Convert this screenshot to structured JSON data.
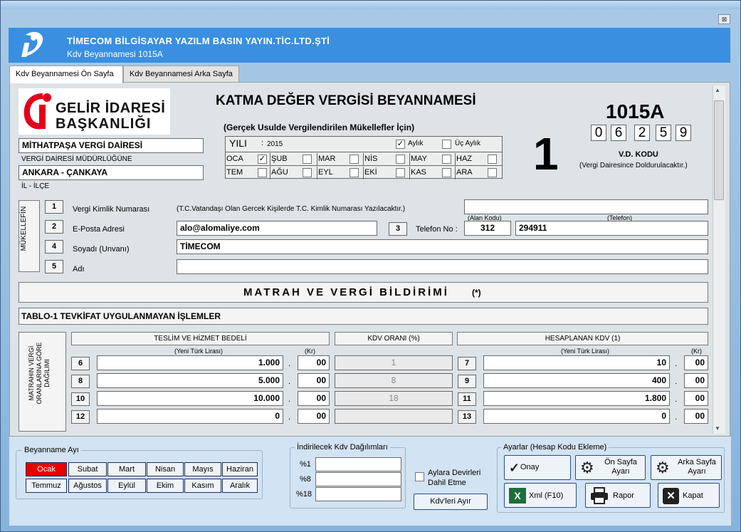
{
  "window": {
    "company": "TİMECOM BİLGİSAYAR YAZILM BASIN YAYIN.TİC.LTD.ŞTİ",
    "subtitle": "Kdv Beyannamesi 1015A",
    "close": "⊠"
  },
  "tabs": [
    "Kdv Beyannamesi Ön Sayfa",
    "Kdv Beyannamesi Arka Sayfa"
  ],
  "logo": {
    "line1": "GELİR İDARESİ",
    "line2": "BAŞKANLIĞI",
    "brand_color": "#e3001b"
  },
  "form": {
    "title": "KATMA DEĞER VERGİSİ BEYANNAMESİ",
    "subtitle": "(Gerçek Usulde Vergilendirilen Mükellefler İçin)",
    "code": "1015A",
    "vd_digits": [
      "0",
      "6",
      "2",
      "5",
      "9"
    ],
    "vd_label": "V.D. KODU",
    "vd_note": "(Vergi Dairesince Doldurulacaktır.)",
    "big_number": "1",
    "office": "MİTHATPAŞA VERGİ DAİRESİ",
    "office_label": "VERGİ DAİRESİ MÜDÜRLÜĞÜNE",
    "city": "ANKARA - ÇANKAYA",
    "city_label": "İL - İLÇE",
    "year_label": "YILI",
    "year_sep": ":",
    "year": "2015",
    "monthly": "Aylık",
    "quarterly": "Üç Aylık",
    "months": [
      "OCA",
      "ŞUB",
      "MAR",
      "NİS",
      "MAY",
      "HAZ",
      "TEM",
      "AĞU",
      "EYL",
      "EKİ",
      "KAS",
      "ARA"
    ],
    "taxpayer_vertical": "MÜKELLEFİN",
    "fields": [
      {
        "no": "1",
        "label": "Vergi  Kimlik Numarası",
        "note": "(T.C.Vatandaşı Olan Gercek Kişilerde T.C. Kimlik Numarası Yazılacaktır.)",
        "value": ""
      },
      {
        "no": "2",
        "label": "E-Posta Adresi",
        "value": "alo@alomaliye.com"
      },
      {
        "no": "4",
        "label": "Soyadı (Unvanı)",
        "value": "TİMECOM"
      },
      {
        "no": "5",
        "label": "Adı",
        "value": ""
      }
    ],
    "phone": {
      "no": "3",
      "label": "Telefon No :",
      "area_label": "(Alan Kodu)",
      "phone_label": "(Telefon)",
      "area": "312",
      "number": "294911"
    },
    "section_title": "MATRAH VE VERGİ BİLDİRİMİ",
    "section_suffix": "(*)",
    "table_title": "TABLO-1   TEVKİFAT UYGULANMAYAN İŞLEMLER",
    "table_vertical": "MATRAHIN VERGİ ORANLARINA GÖRE DAĞILIMI",
    "col1": "TESLİM VE HİZMET BEDELİ",
    "col2": "KDV ORANI (%)",
    "col3": "HESAPLANAN KDV (1)",
    "sub_tl": "(Yeni Türk Lirası)",
    "sub_kr": "(Kr)",
    "rows": [
      {
        "n1": "6",
        "amt": "1.000",
        "kr": "00",
        "rate": "1",
        "n2": "7",
        "kdv": "10",
        "kr2": "00"
      },
      {
        "n1": "8",
        "amt": "5.000",
        "kr": "00",
        "rate": "8",
        "n2": "9",
        "kdv": "400",
        "kr2": "00"
      },
      {
        "n1": "10",
        "amt": "10.000",
        "kr": "00",
        "rate": "18",
        "n2": "11",
        "kdv": "1.800",
        "kr2": "00"
      },
      {
        "n1": "12",
        "amt": "0",
        "kr": "00",
        "rate": "",
        "n2": "13",
        "kdv": "0",
        "kr2": "00"
      }
    ]
  },
  "bottom": {
    "month_group": "Beyanname Ayı",
    "months": [
      "Ocak",
      "Subat",
      "Mart",
      "Nisan",
      "Mayıs",
      "Haziran",
      "Temmuz",
      "Ağustos",
      "Eylül",
      "Ekim",
      "Kasım",
      "Aralık"
    ],
    "selected_month": "Ocak",
    "kdv_group": "İndirilecek Kdv Dağılımları",
    "rates": [
      "%1",
      "%8",
      "%18"
    ],
    "carry": "Aylara Devirleri Dahil Etme",
    "split_btn": "Kdv'leri Ayır",
    "settings_group": "Ayarlar (Hesap Kodu Ekleme)",
    "onay": "Onay",
    "on_sayfa": "Ön Sayfa Ayarı",
    "arka_sayfa": "Arka Sayfa Ayarı",
    "xml": "Xml (F10)",
    "rapor": "Rapor",
    "kapat": "Kapat"
  }
}
